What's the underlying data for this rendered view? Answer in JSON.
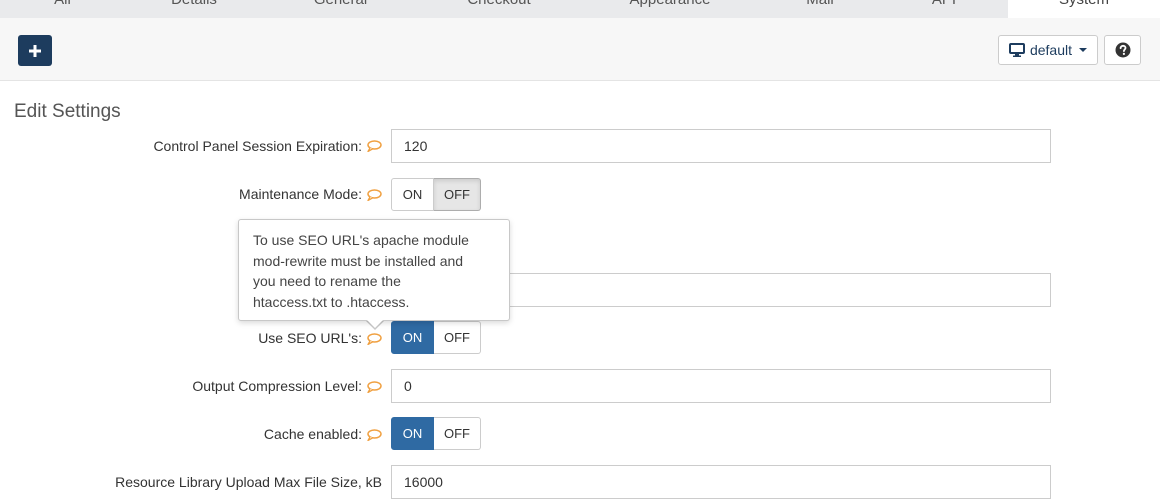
{
  "tabs": [
    {
      "label": "All",
      "active": false
    },
    {
      "label": "Details",
      "active": false
    },
    {
      "label": "General",
      "active": false
    },
    {
      "label": "Checkout",
      "active": false
    },
    {
      "label": "Appearance",
      "active": false
    },
    {
      "label": "Mail",
      "active": false
    },
    {
      "label": "API",
      "active": false
    },
    {
      "label": "System",
      "active": true
    }
  ],
  "toolbar": {
    "add_icon": "plus-icon",
    "template_icon": "monitor-icon",
    "template_label": "default",
    "help_icon": "question-circle-icon"
  },
  "section_title": "Edit Settings",
  "fields": {
    "session_expiration": {
      "label": "Control Panel Session Expiration:",
      "value": "120"
    },
    "maintenance_mode": {
      "label": "Maintenance Mode:",
      "on": "ON",
      "off": "OFF",
      "selected": "OFF"
    },
    "seo_urls": {
      "label": "Use SEO URL's:",
      "on": "ON",
      "off": "OFF",
      "selected": "ON"
    },
    "output_compression": {
      "label": "Output Compression Level:",
      "value": "0"
    },
    "cache_enabled": {
      "label": "Cache enabled:",
      "on": "ON",
      "off": "OFF",
      "selected": "ON"
    },
    "upload_max_size": {
      "label": "Resource Library Upload Max File Size, kB",
      "value": "16000"
    }
  },
  "tooltip": {
    "lines": [
      "To use SEO URL's apache module",
      "mod-rewrite must be installed and",
      "you need to rename the",
      "htaccess.txt to .htaccess."
    ]
  },
  "colors": {
    "primary": "#1d3c5e",
    "toggle_on": "#2f6aa3",
    "help_bubble": "#f0a040"
  }
}
